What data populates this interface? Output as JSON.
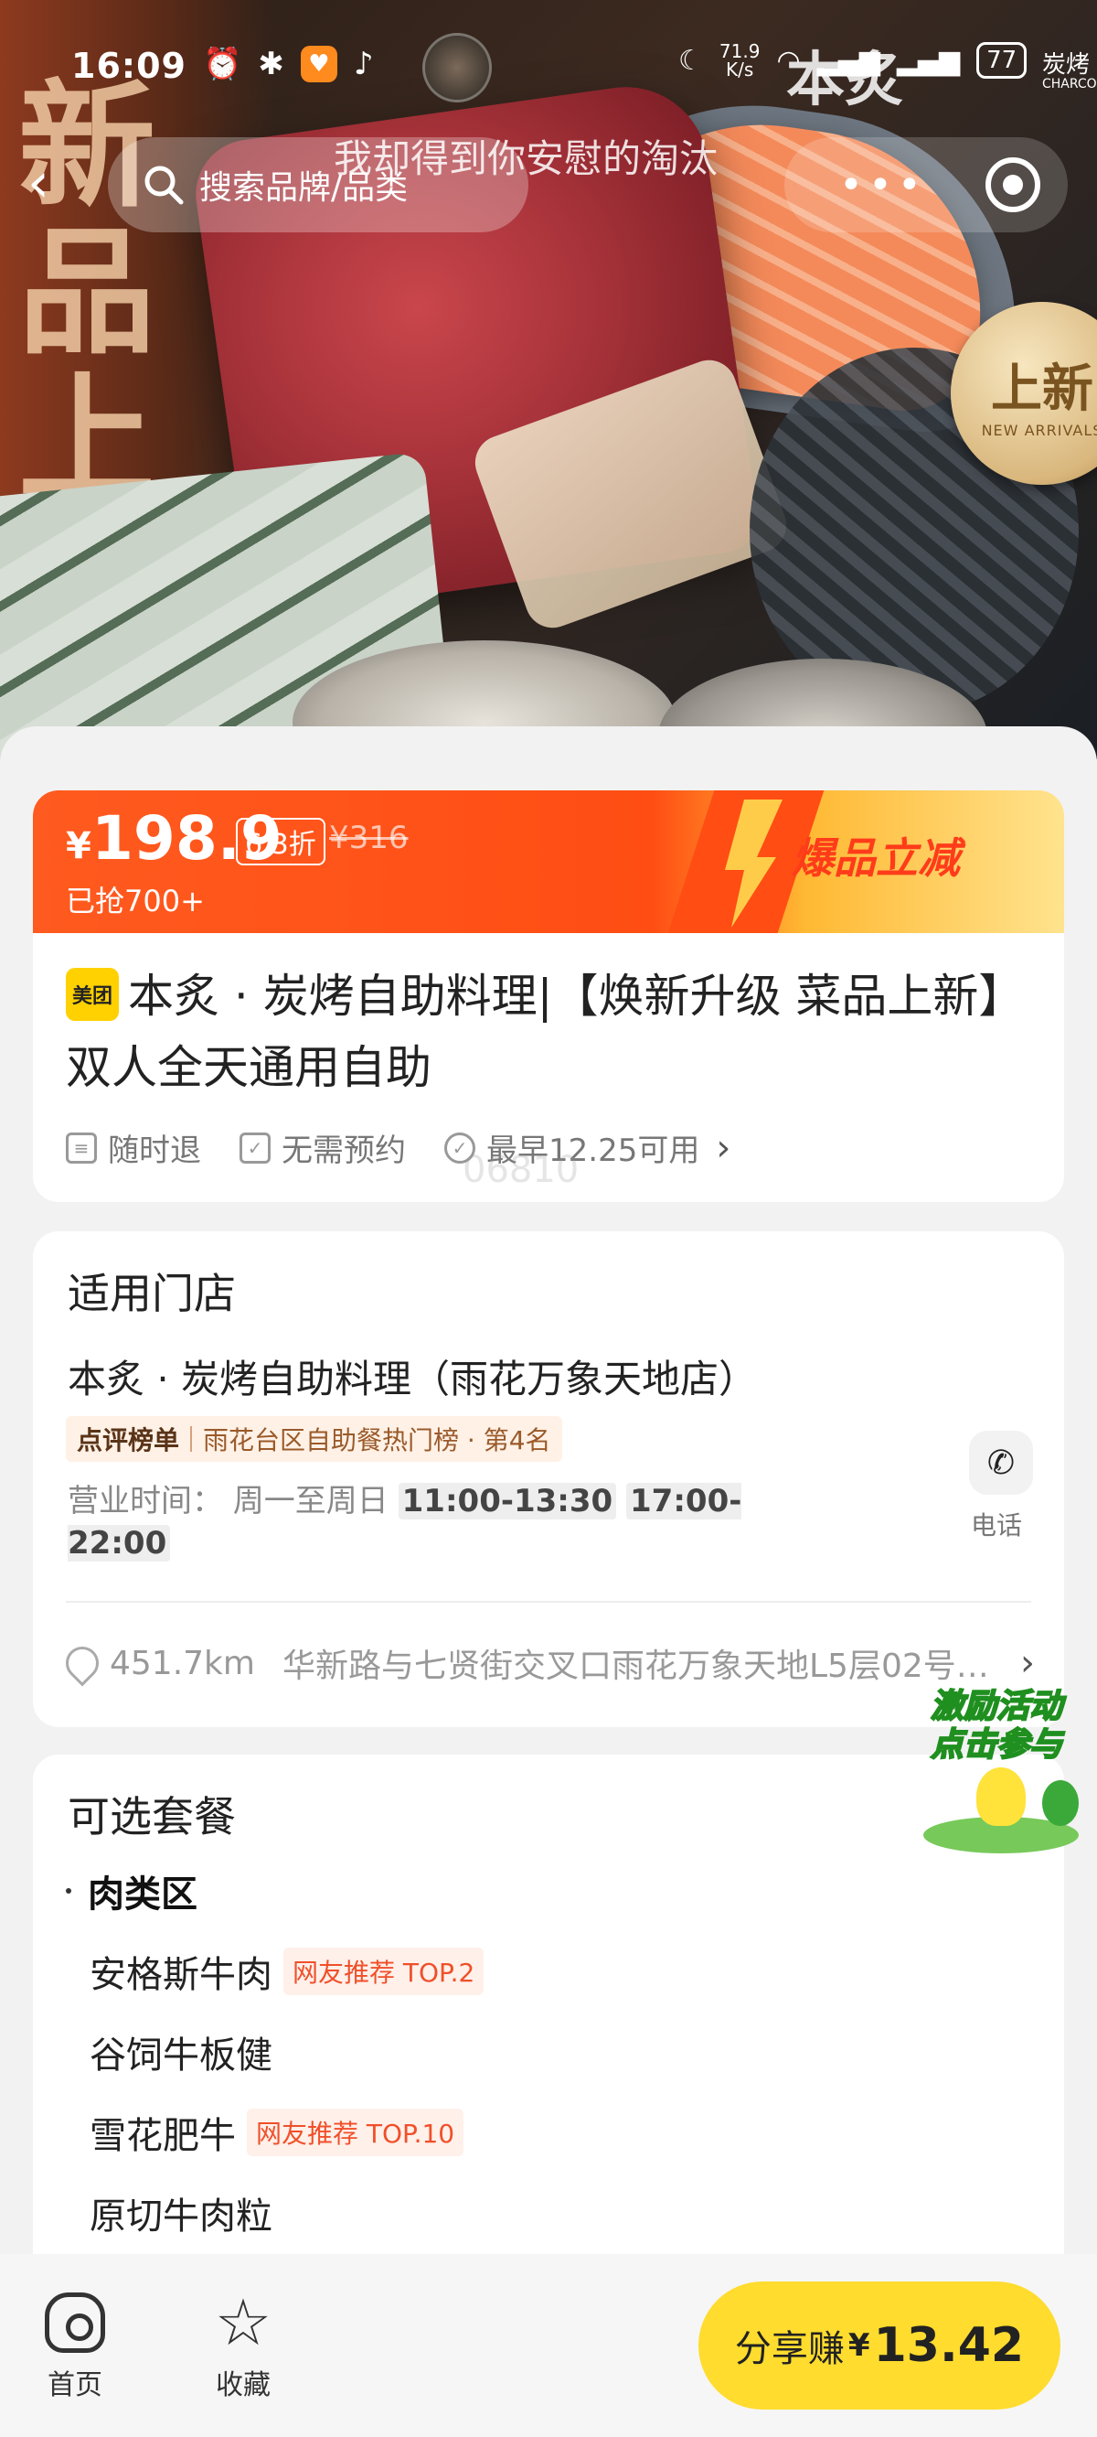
{
  "status_bar": {
    "time": "16:09",
    "net_speed_value": "71.9",
    "net_speed_unit": "K/s",
    "battery": "77",
    "brand_logo": "本炙",
    "brand_sub": "炭烤",
    "brand_sub2": "CHARCO"
  },
  "hero": {
    "vertical_text": "新品上新",
    "seal_main": "上新",
    "seal_sub": "NEW ARRIVALS"
  },
  "nav": {
    "search_placeholder": "搜索品牌/品类",
    "marquee": "我却得到你安慰的淘汰",
    "menu_dots": "•••"
  },
  "price": {
    "currency": "¥",
    "value": "198.9",
    "discount": "6.3折",
    "original": "¥316",
    "sold": "已抢700+",
    "slogan": "爆品立减"
  },
  "deal": {
    "platform_badge": "美团",
    "title": "本炙 · 炭烤自助料理|【焕新升级 菜品上新】双人全天通用自助",
    "tags": [
      "随时退",
      "无需预约",
      "最早12.25可用"
    ],
    "watermark": "06810"
  },
  "store": {
    "section_title": "适用门店",
    "name": "本炙 · 炭烤自助料理（雨花万象天地店）",
    "rank_label": "点评榜单",
    "rank_text": "雨花台区自助餐热门榜 · 第4名",
    "hours_label": "营业时间：",
    "hours_days": "周一至周日",
    "hours_range1": "11:00-13:30",
    "hours_range2": "17:00-22:00",
    "phone_label": "电话",
    "distance": "451.7km",
    "address": "华新路与七贤街交叉口雨花万象天地L5层02号…"
  },
  "promo": {
    "line1": "激励活动",
    "line2": "点击参与"
  },
  "packages": {
    "section_title": "可选套餐",
    "category": "肉类区",
    "items": [
      {
        "name": "安格斯牛肉",
        "badge": "网友推荐 TOP.2"
      },
      {
        "name": "谷饲牛板健",
        "badge": ""
      },
      {
        "name": "雪花肥牛",
        "badge": "网友推荐 TOP.10"
      },
      {
        "name": "原切牛肉粒",
        "badge": ""
      }
    ]
  },
  "bottom_bar": {
    "home_label": "首页",
    "fav_label": "收藏",
    "share_label": "分享赚",
    "share_currency": "¥",
    "share_amount": "13.42"
  },
  "colors": {
    "accent_orange": "#ff4d14",
    "share_yellow": "#ffdc2e",
    "badge_red": "#f0502a"
  }
}
